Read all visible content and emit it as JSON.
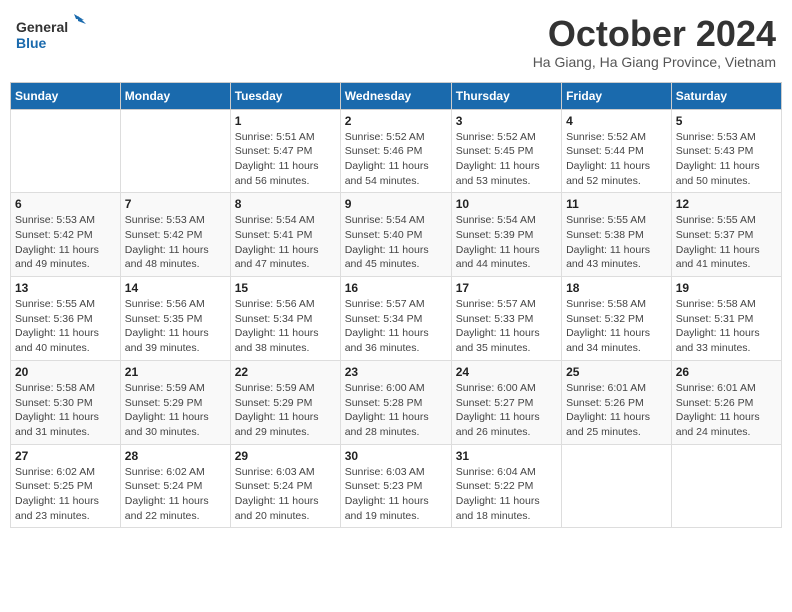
{
  "header": {
    "logo_general": "General",
    "logo_blue": "Blue",
    "month_year": "October 2024",
    "location": "Ha Giang, Ha Giang Province, Vietnam"
  },
  "weekdays": [
    "Sunday",
    "Monday",
    "Tuesday",
    "Wednesday",
    "Thursday",
    "Friday",
    "Saturday"
  ],
  "weeks": [
    [
      {
        "day": "",
        "info": ""
      },
      {
        "day": "",
        "info": ""
      },
      {
        "day": "1",
        "info": "Sunrise: 5:51 AM\nSunset: 5:47 PM\nDaylight: 11 hours and 56 minutes."
      },
      {
        "day": "2",
        "info": "Sunrise: 5:52 AM\nSunset: 5:46 PM\nDaylight: 11 hours and 54 minutes."
      },
      {
        "day": "3",
        "info": "Sunrise: 5:52 AM\nSunset: 5:45 PM\nDaylight: 11 hours and 53 minutes."
      },
      {
        "day": "4",
        "info": "Sunrise: 5:52 AM\nSunset: 5:44 PM\nDaylight: 11 hours and 52 minutes."
      },
      {
        "day": "5",
        "info": "Sunrise: 5:53 AM\nSunset: 5:43 PM\nDaylight: 11 hours and 50 minutes."
      }
    ],
    [
      {
        "day": "6",
        "info": "Sunrise: 5:53 AM\nSunset: 5:42 PM\nDaylight: 11 hours and 49 minutes."
      },
      {
        "day": "7",
        "info": "Sunrise: 5:53 AM\nSunset: 5:42 PM\nDaylight: 11 hours and 48 minutes."
      },
      {
        "day": "8",
        "info": "Sunrise: 5:54 AM\nSunset: 5:41 PM\nDaylight: 11 hours and 47 minutes."
      },
      {
        "day": "9",
        "info": "Sunrise: 5:54 AM\nSunset: 5:40 PM\nDaylight: 11 hours and 45 minutes."
      },
      {
        "day": "10",
        "info": "Sunrise: 5:54 AM\nSunset: 5:39 PM\nDaylight: 11 hours and 44 minutes."
      },
      {
        "day": "11",
        "info": "Sunrise: 5:55 AM\nSunset: 5:38 PM\nDaylight: 11 hours and 43 minutes."
      },
      {
        "day": "12",
        "info": "Sunrise: 5:55 AM\nSunset: 5:37 PM\nDaylight: 11 hours and 41 minutes."
      }
    ],
    [
      {
        "day": "13",
        "info": "Sunrise: 5:55 AM\nSunset: 5:36 PM\nDaylight: 11 hours and 40 minutes."
      },
      {
        "day": "14",
        "info": "Sunrise: 5:56 AM\nSunset: 5:35 PM\nDaylight: 11 hours and 39 minutes."
      },
      {
        "day": "15",
        "info": "Sunrise: 5:56 AM\nSunset: 5:34 PM\nDaylight: 11 hours and 38 minutes."
      },
      {
        "day": "16",
        "info": "Sunrise: 5:57 AM\nSunset: 5:34 PM\nDaylight: 11 hours and 36 minutes."
      },
      {
        "day": "17",
        "info": "Sunrise: 5:57 AM\nSunset: 5:33 PM\nDaylight: 11 hours and 35 minutes."
      },
      {
        "day": "18",
        "info": "Sunrise: 5:58 AM\nSunset: 5:32 PM\nDaylight: 11 hours and 34 minutes."
      },
      {
        "day": "19",
        "info": "Sunrise: 5:58 AM\nSunset: 5:31 PM\nDaylight: 11 hours and 33 minutes."
      }
    ],
    [
      {
        "day": "20",
        "info": "Sunrise: 5:58 AM\nSunset: 5:30 PM\nDaylight: 11 hours and 31 minutes."
      },
      {
        "day": "21",
        "info": "Sunrise: 5:59 AM\nSunset: 5:29 PM\nDaylight: 11 hours and 30 minutes."
      },
      {
        "day": "22",
        "info": "Sunrise: 5:59 AM\nSunset: 5:29 PM\nDaylight: 11 hours and 29 minutes."
      },
      {
        "day": "23",
        "info": "Sunrise: 6:00 AM\nSunset: 5:28 PM\nDaylight: 11 hours and 28 minutes."
      },
      {
        "day": "24",
        "info": "Sunrise: 6:00 AM\nSunset: 5:27 PM\nDaylight: 11 hours and 26 minutes."
      },
      {
        "day": "25",
        "info": "Sunrise: 6:01 AM\nSunset: 5:26 PM\nDaylight: 11 hours and 25 minutes."
      },
      {
        "day": "26",
        "info": "Sunrise: 6:01 AM\nSunset: 5:26 PM\nDaylight: 11 hours and 24 minutes."
      }
    ],
    [
      {
        "day": "27",
        "info": "Sunrise: 6:02 AM\nSunset: 5:25 PM\nDaylight: 11 hours and 23 minutes."
      },
      {
        "day": "28",
        "info": "Sunrise: 6:02 AM\nSunset: 5:24 PM\nDaylight: 11 hours and 22 minutes."
      },
      {
        "day": "29",
        "info": "Sunrise: 6:03 AM\nSunset: 5:24 PM\nDaylight: 11 hours and 20 minutes."
      },
      {
        "day": "30",
        "info": "Sunrise: 6:03 AM\nSunset: 5:23 PM\nDaylight: 11 hours and 19 minutes."
      },
      {
        "day": "31",
        "info": "Sunrise: 6:04 AM\nSunset: 5:22 PM\nDaylight: 11 hours and 18 minutes."
      },
      {
        "day": "",
        "info": ""
      },
      {
        "day": "",
        "info": ""
      }
    ]
  ]
}
